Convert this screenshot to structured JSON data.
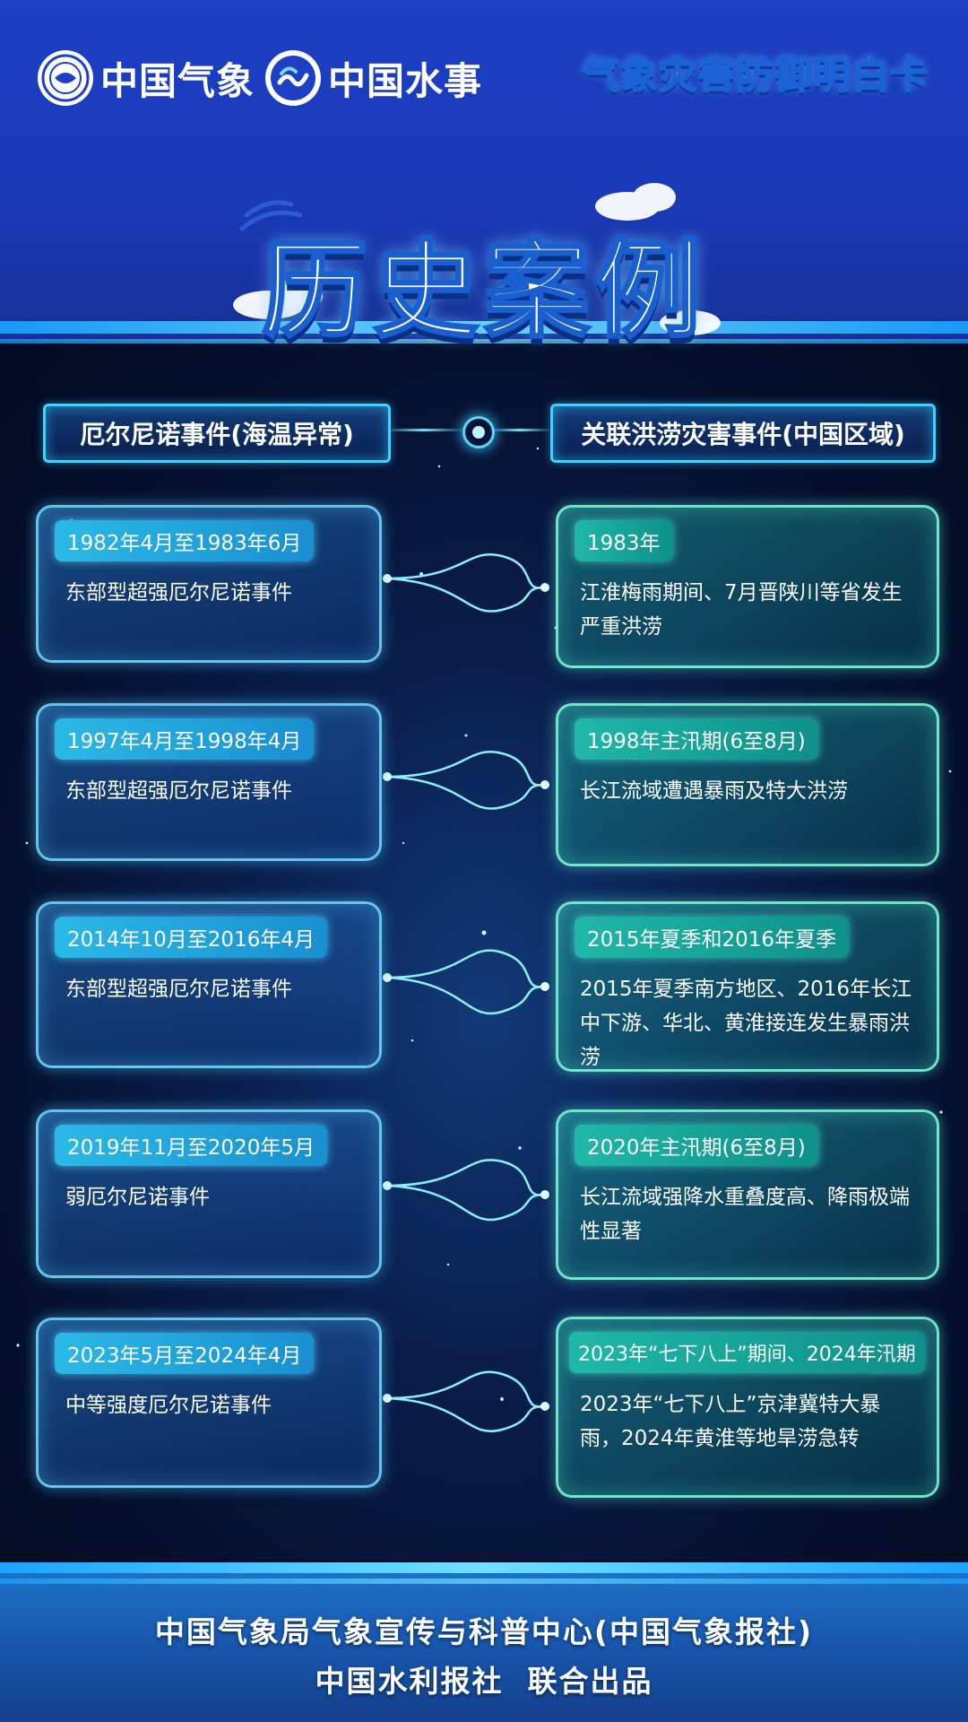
{
  "header": {
    "logo1_text": "中国气象",
    "logo2_text": "中国水事",
    "card_title": "气象灾害防御明白卡"
  },
  "title": "历史案例",
  "columns": {
    "left": "厄尔尼诺事件(海温异常)",
    "right": "关联洪涝灾害事件(中国区域)"
  },
  "cases": [
    {
      "left_period": "1982年4月至1983年6月",
      "left_desc": "东部型超强厄尔尼诺事件",
      "right_period": "1983年",
      "right_desc": "江淮梅雨期间、7月晋陕川等省发生严重洪涝"
    },
    {
      "left_period": "1997年4月至1998年4月",
      "left_desc": "东部型超强厄尔尼诺事件",
      "right_period": "1998年主汛期(6至8月)",
      "right_desc": "长江流域遭遇暴雨及特大洪涝"
    },
    {
      "left_period": "2014年10月至2016年4月",
      "left_desc": "东部型超强厄尔尼诺事件",
      "right_period": "2015年夏季和2016年夏季",
      "right_desc": "2015年夏季南方地区、2016年长江中下游、华北、黄淮接连发生暴雨洪涝"
    },
    {
      "left_period": "2019年11月至2020年5月",
      "left_desc": "弱厄尔尼诺事件",
      "right_period": "2020年主汛期(6至8月)",
      "right_desc": "长江流域强降水重叠度高、降雨极端性显著"
    },
    {
      "left_period": "2023年5月至2024年4月",
      "left_desc": "中等强度厄尔尼诺事件",
      "right_period": "2023年“七下八上”期间、2024年汛期",
      "right_desc": "2023年“七下八上”京津冀特大暴雨，2024年黄淮等地旱涝急转"
    }
  ],
  "footer": {
    "line1": "中国气象局气象宣传与科普中心(中国气象报社)",
    "line2": "中国水利报社  联合出品"
  },
  "colors": {
    "accent_cyan": "#3ad4ff",
    "accent_teal": "#5fffd8",
    "bg_blue": "#1c3fc4"
  },
  "icons": {
    "logo1": "cma-logo-icon",
    "logo2": "water-logo-icon"
  }
}
